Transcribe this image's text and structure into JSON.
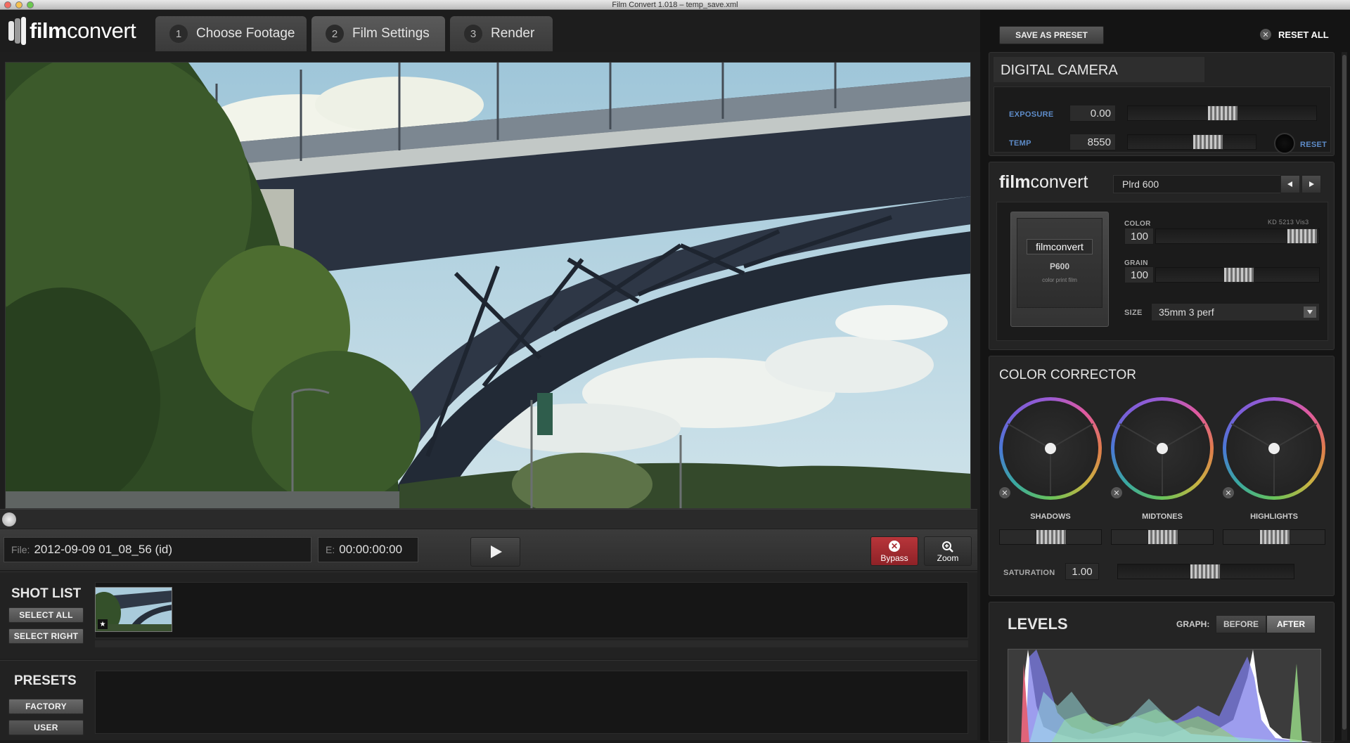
{
  "window": {
    "title": "Film Convert 1.018 – temp_save.xml"
  },
  "logo": {
    "brand_bold": "film",
    "brand_light": "convert"
  },
  "tabs": [
    {
      "num": "1",
      "label": "Choose Footage",
      "active": false
    },
    {
      "num": "2",
      "label": "Film Settings",
      "active": true
    },
    {
      "num": "3",
      "label": "Render",
      "active": false
    }
  ],
  "controls": {
    "file_label": "File:",
    "file_value": "2012-09-09 01_08_56 (id)",
    "time_label": "E:",
    "time_value": "00:00:00:00",
    "bypass_label": "Bypass",
    "zoom_label": "Zoom"
  },
  "shot_list": {
    "title": "SHOT LIST",
    "select_all": "SELECT ALL",
    "select_right": "SELECT RIGHT",
    "thumb_badge": "★"
  },
  "presets": {
    "title": "PRESETS",
    "factory": "FACTORY",
    "user": "USER"
  },
  "right": {
    "save_preset": "SAVE AS PRESET",
    "reset_all": "RESET ALL",
    "digital_camera": {
      "title": "DIGITAL CAMERA",
      "exposure_label": "EXPOSURE",
      "exposure_value": "0.00",
      "temp_label": "TEMP",
      "temp_value": "8550",
      "reset_label": "RESET"
    },
    "film": {
      "brand_bold": "film",
      "brand_light": "convert",
      "stock": "Plrd 600",
      "box_brand": "filmconvert",
      "box_code": "P600",
      "box_desc": "color print film",
      "color_label": "COLOR",
      "color_value": "100",
      "stock_code": "KD 5213 Vis3",
      "grain_label": "GRAIN",
      "grain_value": "100",
      "size_label": "SIZE",
      "size_value": "35mm 3 perf"
    },
    "color_corrector": {
      "title": "COLOR CORRECTOR",
      "wheels": [
        {
          "label": "SHADOWS"
        },
        {
          "label": "MIDTONES"
        },
        {
          "label": "HIGHLIGHTS"
        }
      ],
      "saturation_label": "SATURATION",
      "saturation_value": "1.00"
    },
    "levels": {
      "title": "LEVELS",
      "graph_label": "GRAPH:",
      "before_label": "BEFORE",
      "after_label": "AFTER"
    }
  }
}
